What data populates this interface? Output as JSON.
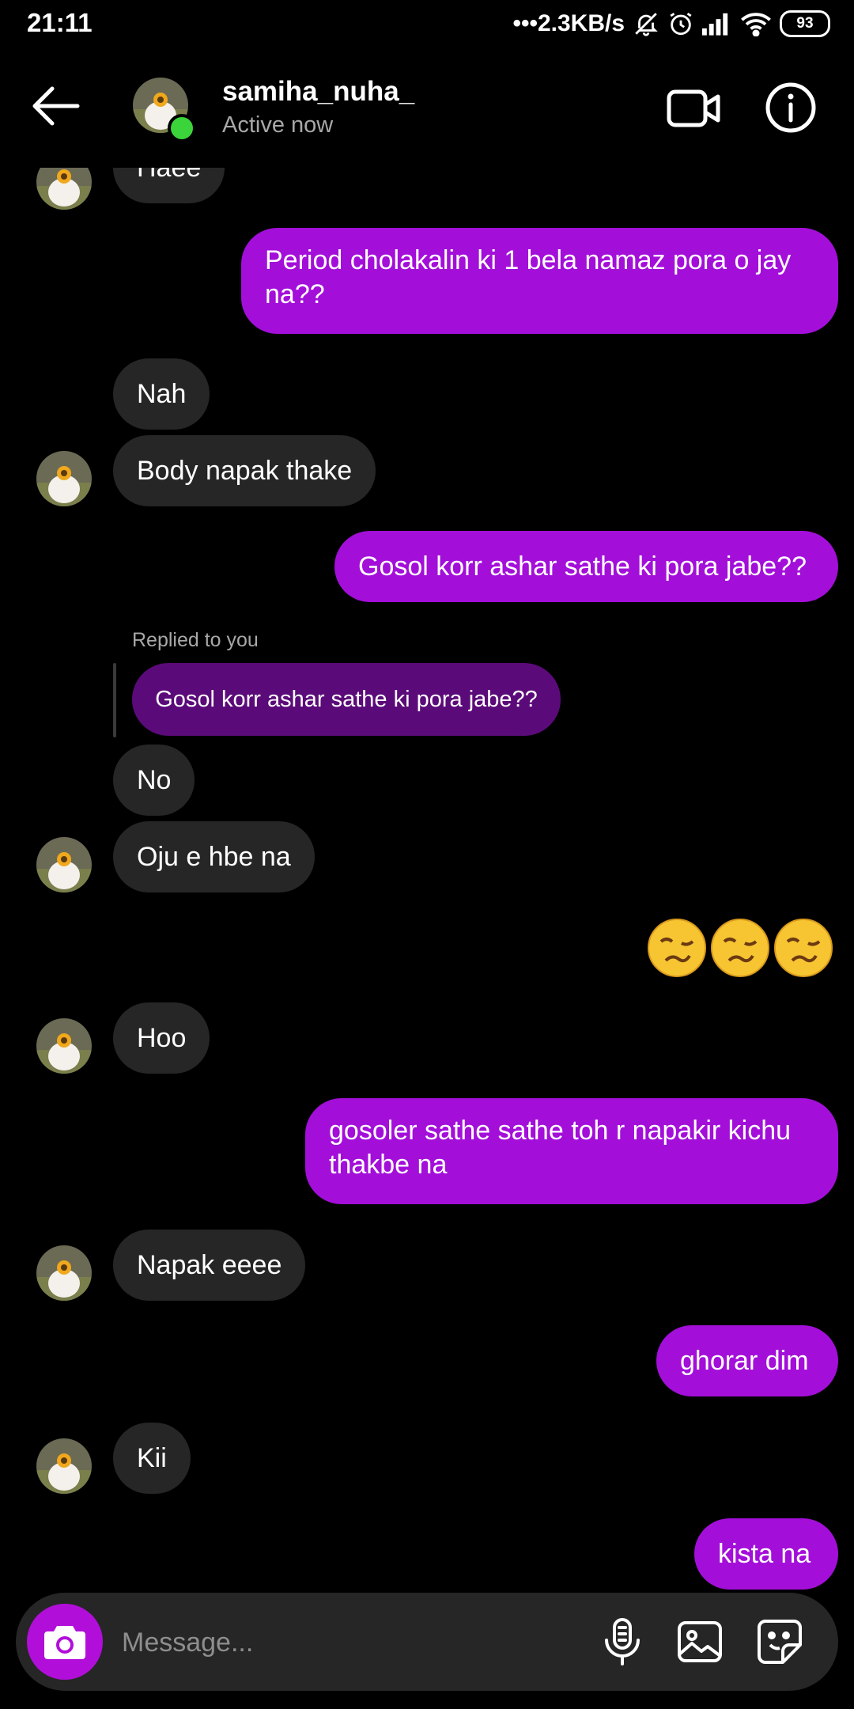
{
  "status_bar": {
    "time": "21:11",
    "network_speed": "•••2.3KB/s",
    "battery": "93"
  },
  "header": {
    "username": "samiha_nuha_",
    "status": "Active now",
    "icons": [
      "back-arrow-icon",
      "video-call-icon",
      "info-icon"
    ]
  },
  "messages": [
    {
      "side": "in",
      "text": "Haee"
    },
    {
      "side": "out",
      "text": "Period cholakalin ki 1 bela namaz pora o jay na??"
    },
    {
      "side": "in",
      "text": "Nah"
    },
    {
      "side": "in",
      "text": "Body napak thake"
    },
    {
      "side": "out",
      "text": "Gosol korr ashar sathe ki pora jabe??"
    },
    {
      "side": "in",
      "reply_label": "Replied to you",
      "quoted": "Gosol korr ashar sathe ki pora jabe??",
      "text": "No"
    },
    {
      "side": "in",
      "text": "Oju e hbe na"
    },
    {
      "side": "out",
      "text": "🥴🥴🥴"
    },
    {
      "side": "in",
      "text": "Hoo"
    },
    {
      "side": "out",
      "text": "gosoler sathe sathe toh r napakir kichu thakbe na"
    },
    {
      "side": "in",
      "text": "Napak eeee"
    },
    {
      "side": "out",
      "text": "ghorar dim"
    },
    {
      "side": "in",
      "text": "Kii"
    },
    {
      "side": "out",
      "text": "kista na"
    }
  ],
  "composer": {
    "placeholder": "Message...",
    "icons": [
      "camera-icon",
      "microphone-icon",
      "gallery-icon",
      "sticker-icon"
    ]
  },
  "colors": {
    "background": "#000000",
    "incoming_bubble": "#262626",
    "outgoing_bubble": "#a30fd9",
    "quoted_bubble": "#5b0b79",
    "online_dot": "#3bd43b",
    "camera_button": "#b10fd9"
  }
}
